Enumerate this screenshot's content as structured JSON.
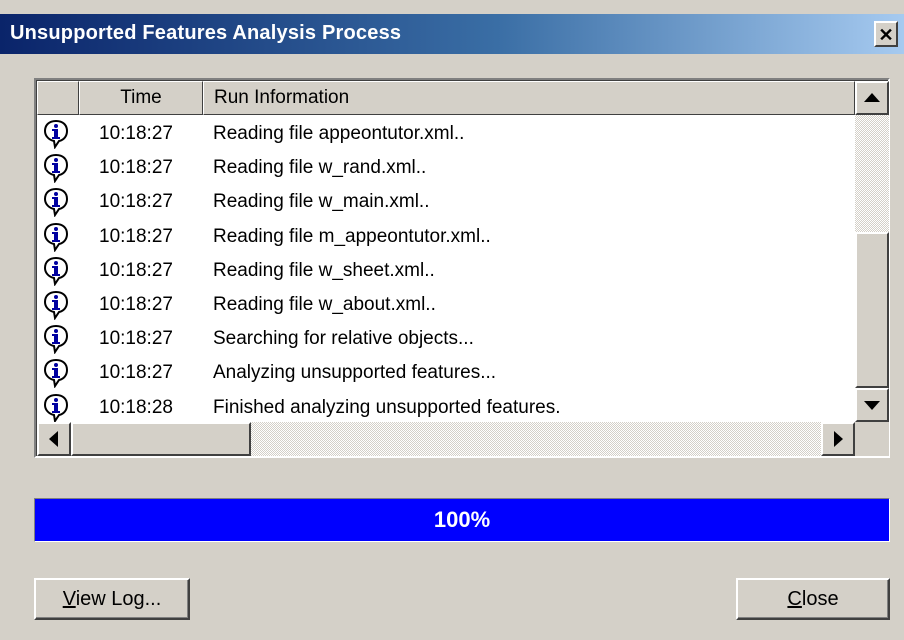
{
  "window": {
    "title": "Unsupported Features Analysis Process",
    "close_glyph": "✕"
  },
  "log": {
    "columns": [
      "",
      "Time",
      "Run Information"
    ],
    "row_icon": "info-balloon-icon",
    "rows": [
      {
        "time": "10:18:27",
        "info": "Reading file appeontutor.xml.."
      },
      {
        "time": "10:18:27",
        "info": "Reading file w_rand.xml.."
      },
      {
        "time": "10:18:27",
        "info": "Reading file w_main.xml.."
      },
      {
        "time": "10:18:27",
        "info": "Reading file m_appeontutor.xml.."
      },
      {
        "time": "10:18:27",
        "info": "Reading file w_sheet.xml.."
      },
      {
        "time": "10:18:27",
        "info": "Reading file w_about.xml.."
      },
      {
        "time": "10:18:27",
        "info": "Searching for relative objects..."
      },
      {
        "time": "10:18:27",
        "info": "Analyzing unsupported features..."
      },
      {
        "time": "10:18:28",
        "info": "Finished analyzing unsupported features."
      }
    ]
  },
  "progress": {
    "value": 1.0,
    "label": "100%",
    "color": "#0000ff"
  },
  "buttons": {
    "view_log": {
      "mnemonic": "V",
      "rest": "iew Log..."
    },
    "close": {
      "mnemonic": "C",
      "rest": "lose"
    }
  },
  "colors": {
    "title_start": "#0a246a",
    "title_end": "#a6caf0",
    "face": "#d4d0c8"
  }
}
